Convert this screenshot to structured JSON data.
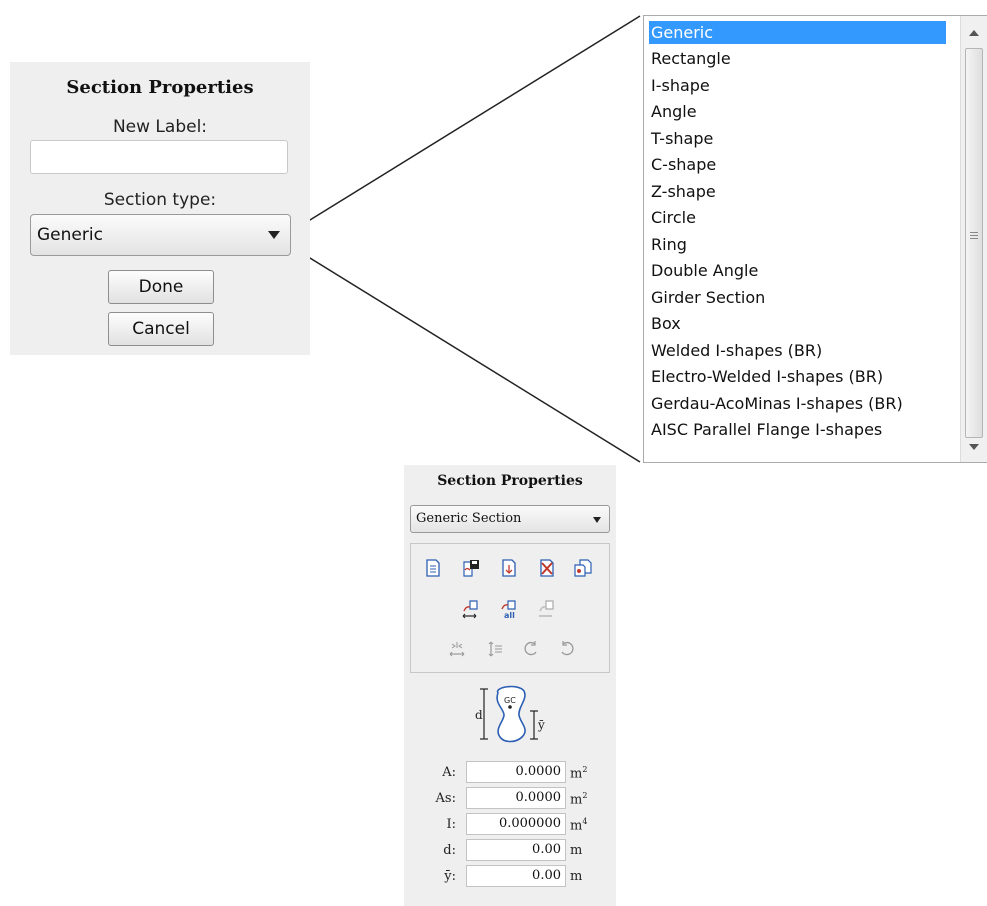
{
  "dialog": {
    "title": "Section Properties",
    "new_label_caption": "New Label:",
    "new_label_value": "",
    "section_type_caption": "Section type:",
    "section_type_selected": "Generic",
    "done_label": "Done",
    "cancel_label": "Cancel"
  },
  "dropdown": {
    "items": [
      "Generic",
      "Rectangle",
      "I-shape",
      "Angle",
      "T-shape",
      "C-shape",
      "Z-shape",
      "Circle",
      "Ring",
      "Double Angle",
      "Girder Section",
      "Box",
      "Welded I-shapes (BR)",
      "Electro-Welded I-shapes (BR)",
      "Gerdau-AcoMinas I-shapes (BR)",
      "AISC Parallel Flange I-shapes"
    ],
    "selected": "Generic"
  },
  "panel": {
    "title": "Section Properties",
    "section_selected": "Generic Section",
    "toolbar_icons": [
      "new-section-icon",
      "save-section-icon",
      "import-section-icon",
      "delete-section-icon",
      "copy-section-icon",
      "assign-section-icon",
      "assign-all-icon",
      "unassign-section-icon",
      "flip-horizontal-icon",
      "flip-vertical-icon",
      "rotate-ccw-icon",
      "rotate-cw-icon"
    ],
    "diagram": {
      "d_label": "d",
      "ybar_label": "ȳ",
      "center_label": "GC"
    },
    "properties": [
      {
        "label": "A:",
        "value": "0.0000",
        "unit": "m",
        "exp": "2"
      },
      {
        "label": "As:",
        "value": "0.0000",
        "unit": "m",
        "exp": "2"
      },
      {
        "label": "I:",
        "value": "0.000000",
        "unit": "m",
        "exp": "4"
      },
      {
        "label": "d:",
        "value": "0.00",
        "unit": "m",
        "exp": ""
      },
      {
        "label": "ȳ:",
        "value": "0.00",
        "unit": "m",
        "exp": ""
      }
    ]
  },
  "colors": {
    "selection": "#3399ff",
    "panel_bg": "#efefef",
    "icon_blue": "#2c5fb3",
    "icon_red": "#c0392b"
  }
}
